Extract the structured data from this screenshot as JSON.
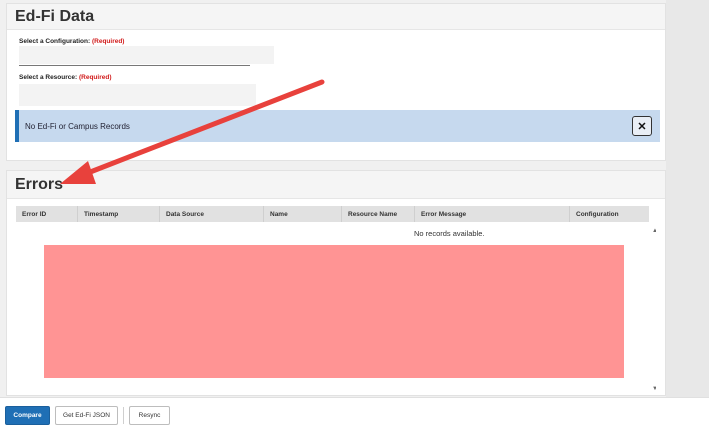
{
  "edfi_panel": {
    "title": "Ed-Fi Data",
    "configuration_label": "Select a Configuration:",
    "resource_label": "Select a Resource:",
    "required_text": "(Required)",
    "alert_text": "No Ed-Fi or Campus Records",
    "close_glyph": "✕"
  },
  "errors_panel": {
    "title": "Errors",
    "columns": [
      "Error ID",
      "Timestamp",
      "Data Source",
      "Name",
      "Resource Name",
      "Error Message",
      "Configuration"
    ],
    "empty_text": "No records available."
  },
  "footer": {
    "compare_label": "Compare",
    "get_json_label": "Get Ed-Fi JSON",
    "resync_label": "Resync"
  },
  "colors": {
    "primary": "#1f6fb5",
    "alert_bg": "#c6d9ee",
    "required": "#d11a1a",
    "annotation_arrow": "#e8413c",
    "redaction": "#ff9494"
  }
}
